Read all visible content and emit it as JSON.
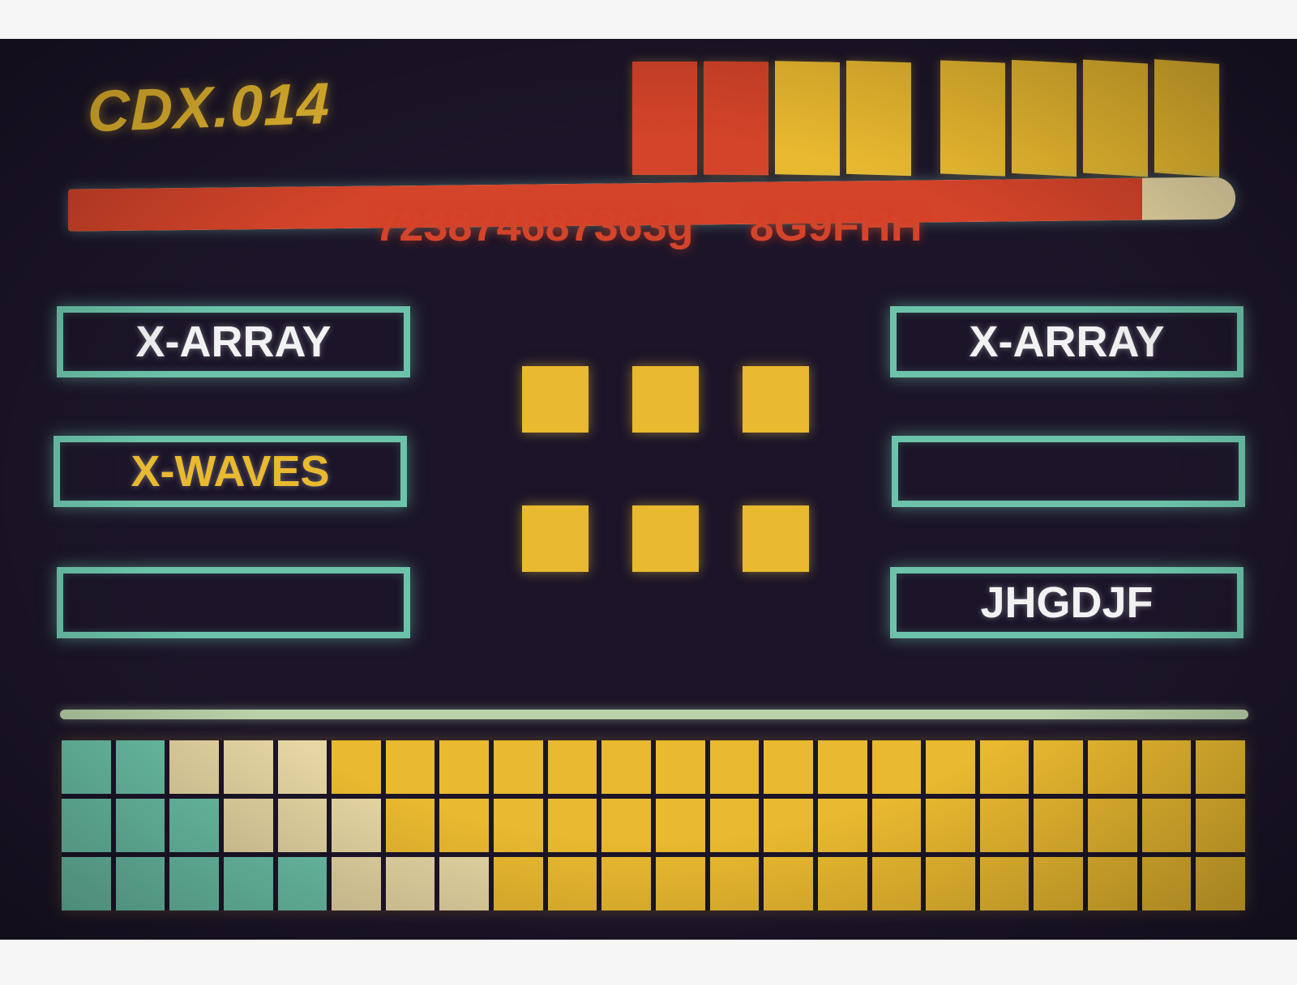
{
  "title": "CDX.014",
  "code": {
    "part1": "723874687363g",
    "part2": "8G9FHH"
  },
  "colors": {
    "background": "#1c1529",
    "yellow": "#e9b92f",
    "red": "#d4442a",
    "teal": "#6cc3a9",
    "cream": "#e6d6a3",
    "white": "#f2f2f2",
    "rail": "#b9d2a9"
  },
  "top_meter": {
    "segments": [
      "red",
      "red",
      "yellow",
      "yellow",
      "yellow",
      "yellow",
      "yellow",
      "yellow"
    ]
  },
  "progress": {
    "value": 0.92
  },
  "left_panels": [
    {
      "label": "X-ARRAY",
      "color": "white"
    },
    {
      "label": "X-WAVES",
      "color": "yellow"
    },
    {
      "label": "",
      "color": "white"
    }
  ],
  "right_panels": [
    {
      "label": "X-ARRAY",
      "color": "white"
    },
    {
      "label": "",
      "color": "white"
    },
    {
      "label": "JHGDJF",
      "color": "white"
    }
  ],
  "indicator_squares": {
    "rows": 2,
    "cols": 3
  },
  "bottom_grid": {
    "cols": 22,
    "rows": 3,
    "teal_cols": [
      2,
      3,
      5
    ],
    "cream_cols": [
      3,
      3,
      3
    ]
  }
}
